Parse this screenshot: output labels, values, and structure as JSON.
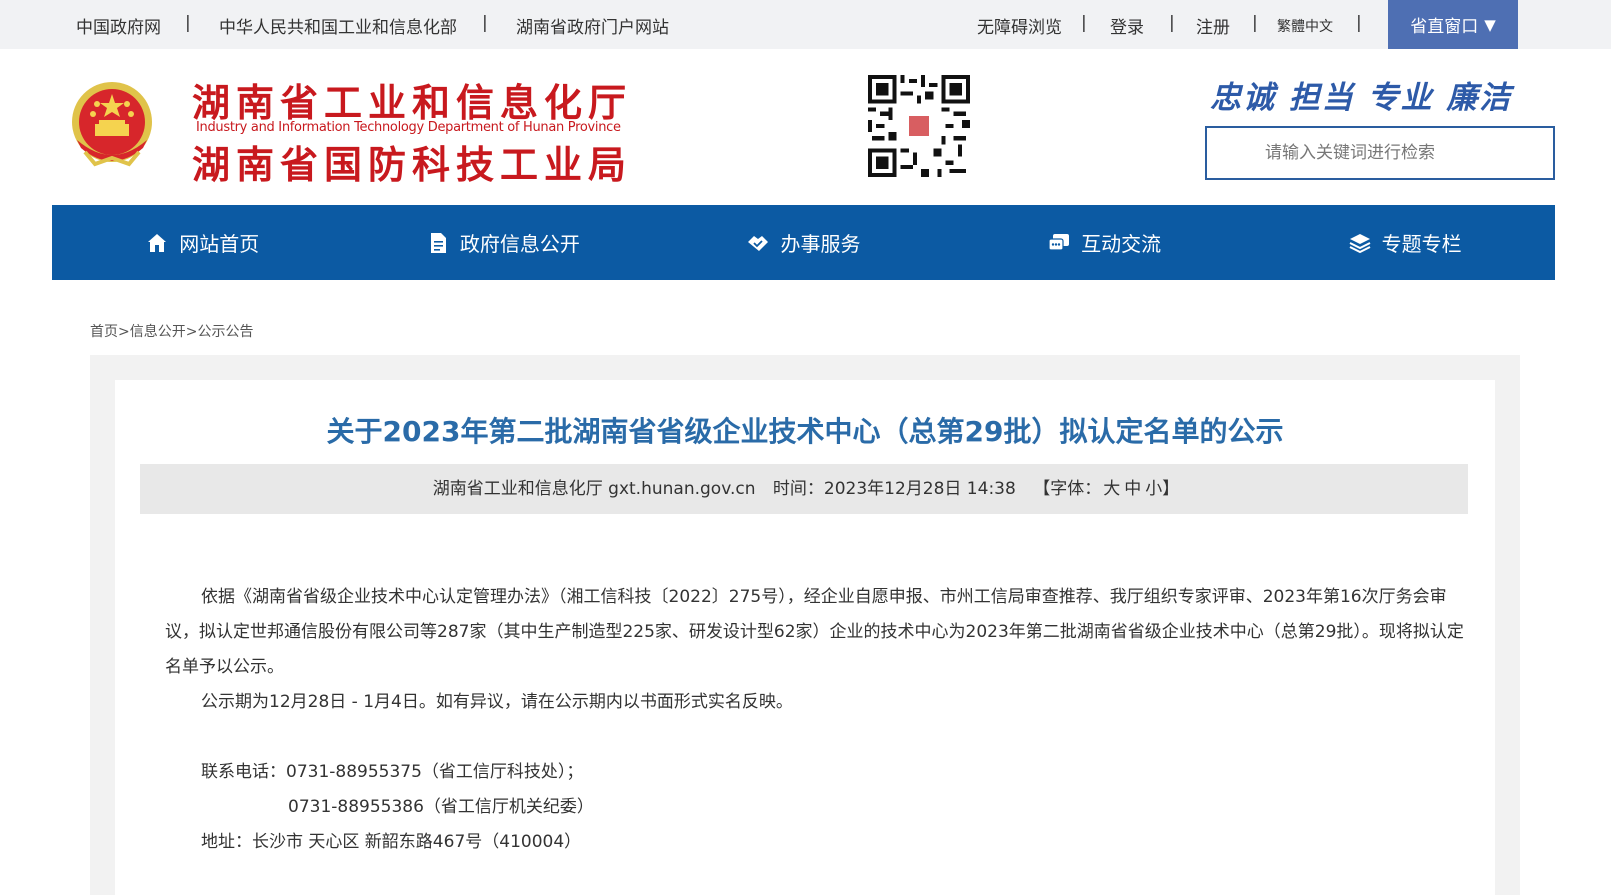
{
  "topbar": {
    "links": [
      "中国政府网",
      "中华人民共和国工业和信息化部",
      "湖南省政府门户网站"
    ],
    "accessibility": "无障碍浏览",
    "login": "登录",
    "register": "注册",
    "lang": "繁體中文",
    "province_window": "省直窗口"
  },
  "header": {
    "title_line1": "湖南省工业和信息化厅",
    "title_en": "Industry and Information Technology Department of Hunan Province",
    "title_line2": "湖南省国防科技工业局",
    "motto": "忠诚 担当 专业 廉洁",
    "search_placeholder": "请输入关键词进行检索"
  },
  "nav": [
    {
      "label": "网站首页",
      "icon": "home-icon"
    },
    {
      "label": "政府信息公开",
      "icon": "document-icon"
    },
    {
      "label": "办事服务",
      "icon": "handshake-icon"
    },
    {
      "label": "互动交流",
      "icon": "chat-icon"
    },
    {
      "label": "专题专栏",
      "icon": "layers-icon"
    }
  ],
  "breadcrumb": "首页>信息公开>公示公告",
  "article": {
    "title": "关于2023年第二批湖南省省级企业技术中心（总第29批）拟认定名单的公示",
    "source": "湖南省工业和信息化厅 gxt.hunan.gov.cn",
    "time": "时间：2023年12月28日 14:38",
    "font_label": "【字体：",
    "font_large": "大",
    "font_medium": "中",
    "font_small": "小】",
    "para1": "依据《湖南省省级企业技术中心认定管理办法》（湘工信科技〔2022〕275号），经企业自愿申报、市州工信局审查推荐、我厅组织专家评审、2023年第16次厅务会审议，拟认定世邦通信股份有限公司等287家（其中生产制造型225家、研发设计型62家）企业的技术中心为2023年第二批湖南省省级企业技术中心（总第29批）。现将拟认定名单予以公示。",
    "para2": "公示期为12月28日 - 1月4日。如有异议，请在公示期内以书面形式实名反映。",
    "contact1": "联系电话：0731-88955375（省工信厅科技处）；",
    "contact2": "0731-88955386（省工信厅机关纪委）",
    "address": "地址：长沙市 天心区 新韶东路467号（410004）"
  },
  "colors": {
    "nav_bg": "#0c5aa3",
    "logo_red": "#c8191e",
    "title_blue": "#2a6ba8",
    "province_btn": "#4e6fb3"
  }
}
